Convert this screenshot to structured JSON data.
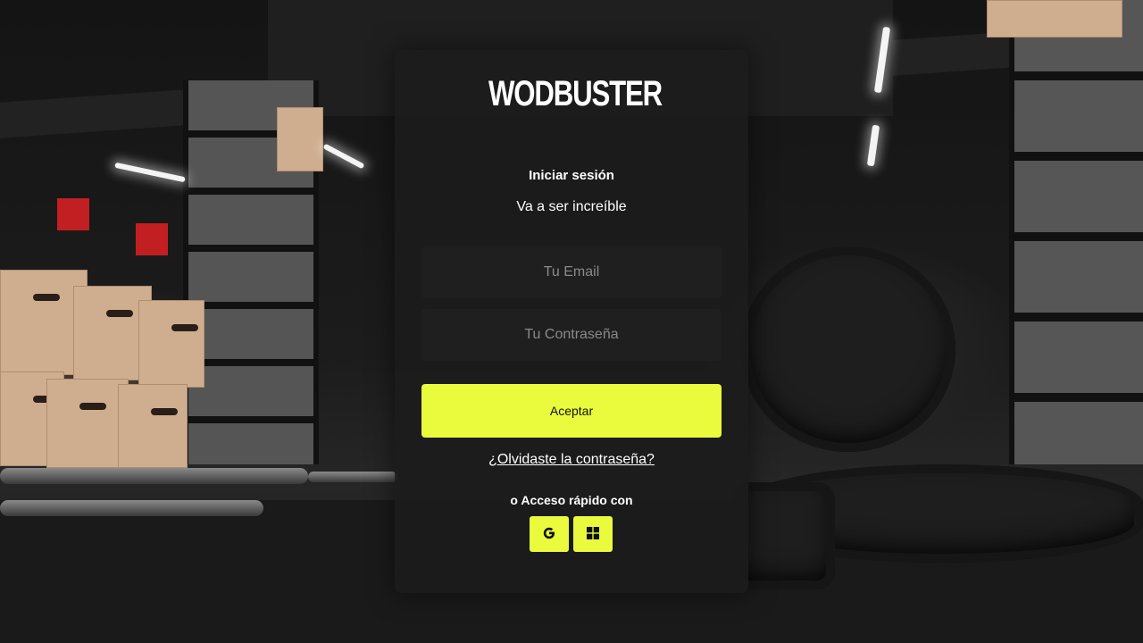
{
  "brand": {
    "name": "WODBUSTER",
    "accent_color": "#e9fb3c"
  },
  "login": {
    "title": "Iniciar sesión",
    "subtitle": "Va a ser increíble",
    "email_placeholder": "Tu Email",
    "password_placeholder": "Tu Contraseña",
    "submit_label": "Aceptar",
    "forgot_label": "¿Olvidaste la contraseña?",
    "quick_access_label": "o Acceso rápido con"
  },
  "social_buttons": [
    {
      "icon": "google-icon"
    },
    {
      "icon": "windows-icon"
    }
  ]
}
